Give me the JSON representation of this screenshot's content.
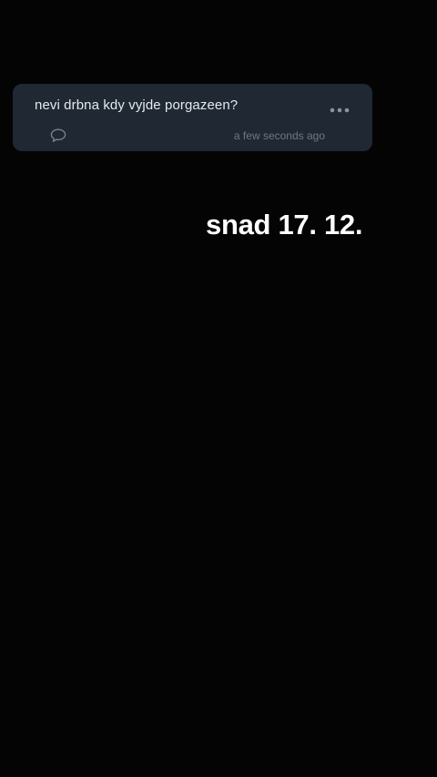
{
  "question_card": {
    "text": "nevi drbna kdy vyjde porgazeen?",
    "timestamp": "a few seconds ago",
    "icons": {
      "more": "more-horizontal-icon",
      "comment": "comment-bubble-icon"
    }
  },
  "caption": {
    "text": "snad 17. 12."
  },
  "colors": {
    "background": "#040404",
    "card": "#1f2833",
    "text_primary": "#e6e9ee",
    "text_muted": "#6f7884",
    "caption": "#ffffff"
  }
}
